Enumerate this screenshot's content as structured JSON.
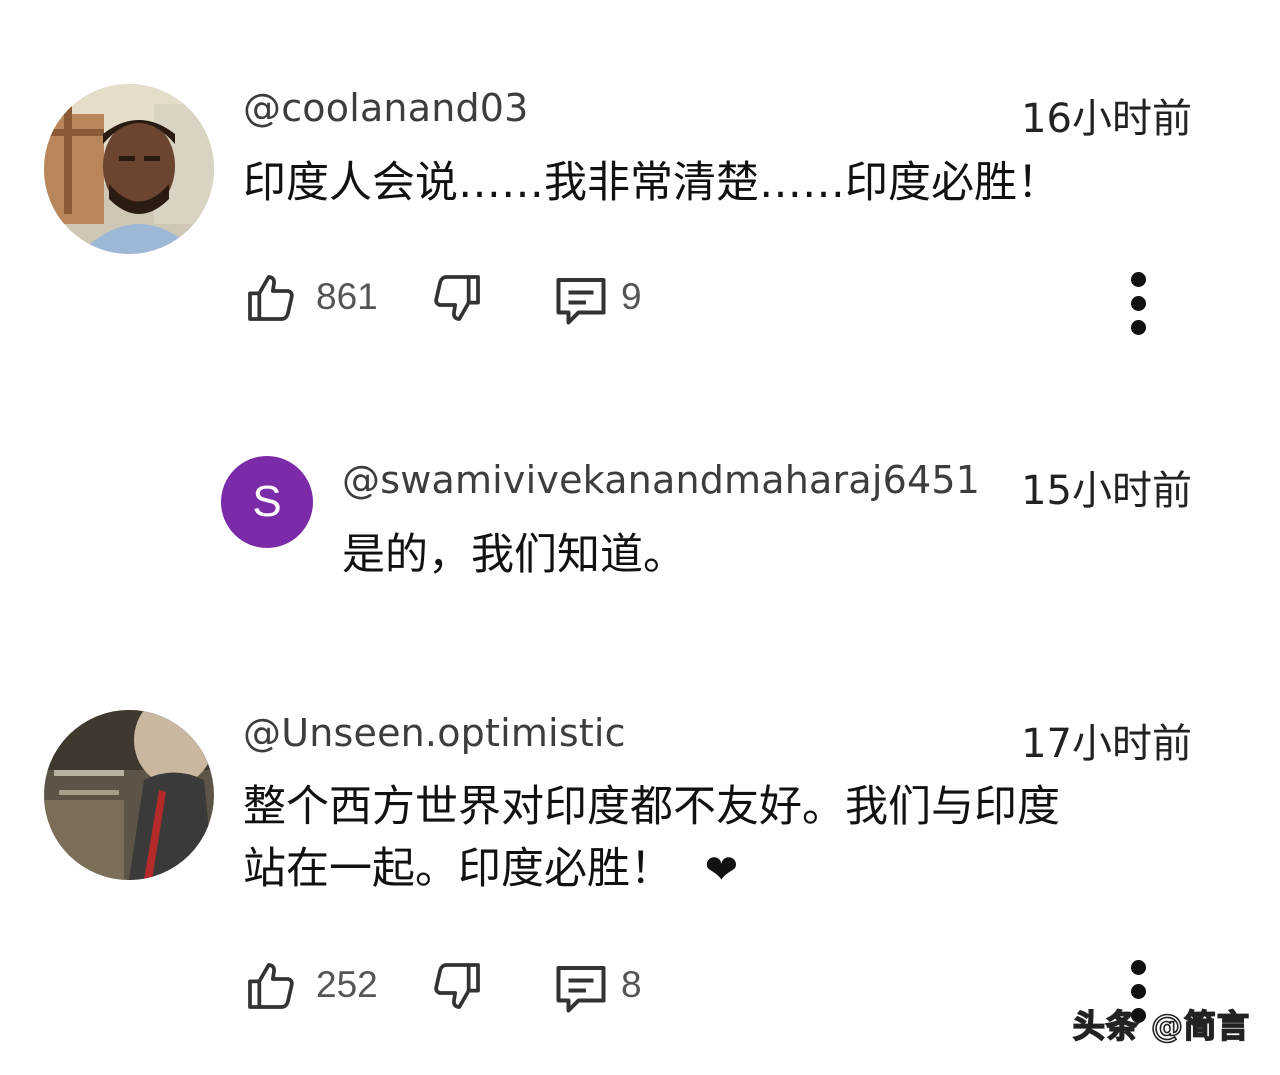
{
  "comments": [
    {
      "handle": "@coolanand03",
      "time": "16小时前",
      "text": "印度人会说……我非常清楚……印度必胜！",
      "likes": "861",
      "replies": "9",
      "avatar": "photo-avatar-man"
    },
    {
      "handle": "@swamivivekanandmaharaj6451",
      "time": "15小时前",
      "text": "是的，我们知道。",
      "avatar_letter": "S",
      "avatar_color": "#7b2aa8",
      "is_reply": true
    },
    {
      "handle": "@Unseen.optimistic",
      "time": "17小时前",
      "text_line1": "整个西方世界对印度都不友好。我们与印度",
      "text_line2": "站在一起。印度必胜！",
      "heart": "❤",
      "likes": "252",
      "replies": "8",
      "avatar": "photo-avatar-blurry"
    }
  ],
  "icons": {
    "like": "thumbs-up-icon",
    "dislike": "thumbs-down-icon",
    "reply": "comment-icon",
    "more": "more-vertical-icon"
  },
  "watermark": "头条 @简言"
}
